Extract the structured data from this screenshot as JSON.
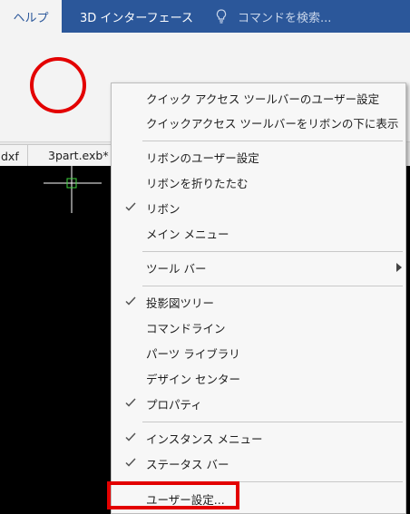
{
  "tabs": {
    "active_label": "ヘルプ",
    "items": [
      {
        "label": "3D インターフェース"
      }
    ],
    "search_placeholder": "コマンドを検索..."
  },
  "document_tabs": [
    {
      "label": "dxf"
    },
    {
      "label": "3part.exb*"
    }
  ],
  "context_menu": {
    "items": [
      {
        "label": "クイック アクセス ツールバーのユーザー設定",
        "checked": false
      },
      {
        "label": "クイックアクセス ツールバーをリボンの下に表示",
        "checked": false
      },
      {
        "label": "リボンのユーザー設定",
        "checked": false
      },
      {
        "label": "リボンを折りたたむ",
        "checked": false
      },
      {
        "label": "リボン",
        "checked": true
      },
      {
        "label": "メイン メニュー",
        "checked": false
      },
      {
        "label": "ツール バー",
        "checked": false,
        "submenu": true
      },
      {
        "label": "投影図ツリー",
        "checked": true
      },
      {
        "label": "コマンドライン",
        "checked": false
      },
      {
        "label": "パーツ ライブラリ",
        "checked": false
      },
      {
        "label": "デザイン センター",
        "checked": false
      },
      {
        "label": "プロパティ",
        "checked": true
      },
      {
        "label": "インスタンス メニュー",
        "checked": true
      },
      {
        "label": "ステータス バー",
        "checked": true
      },
      {
        "label": "ユーザー設定...",
        "checked": false
      }
    ]
  },
  "colors": {
    "title_bar": "#2b579a",
    "annotation_red": "#e30000",
    "canvas": "#000000"
  }
}
